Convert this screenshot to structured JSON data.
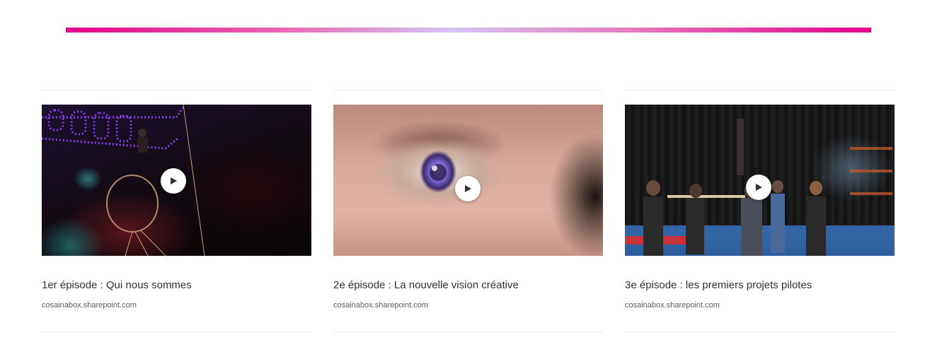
{
  "accent_gradient": [
    "#e3008c",
    "#d4c4f4",
    "#e3008c"
  ],
  "videos": [
    {
      "title": "1er épisode : Qui nous sommes",
      "domain": "cosainabox.sharepoint.com",
      "icon": "play-icon"
    },
    {
      "title": "2e épisode : La nouvelle vision créative",
      "domain": "cosainabox.sharepoint.com",
      "icon": "play-icon"
    },
    {
      "title": "3e épisode : les premiers projets pilotes",
      "domain": "cosainabox.sharepoint.com",
      "icon": "play-icon"
    }
  ]
}
